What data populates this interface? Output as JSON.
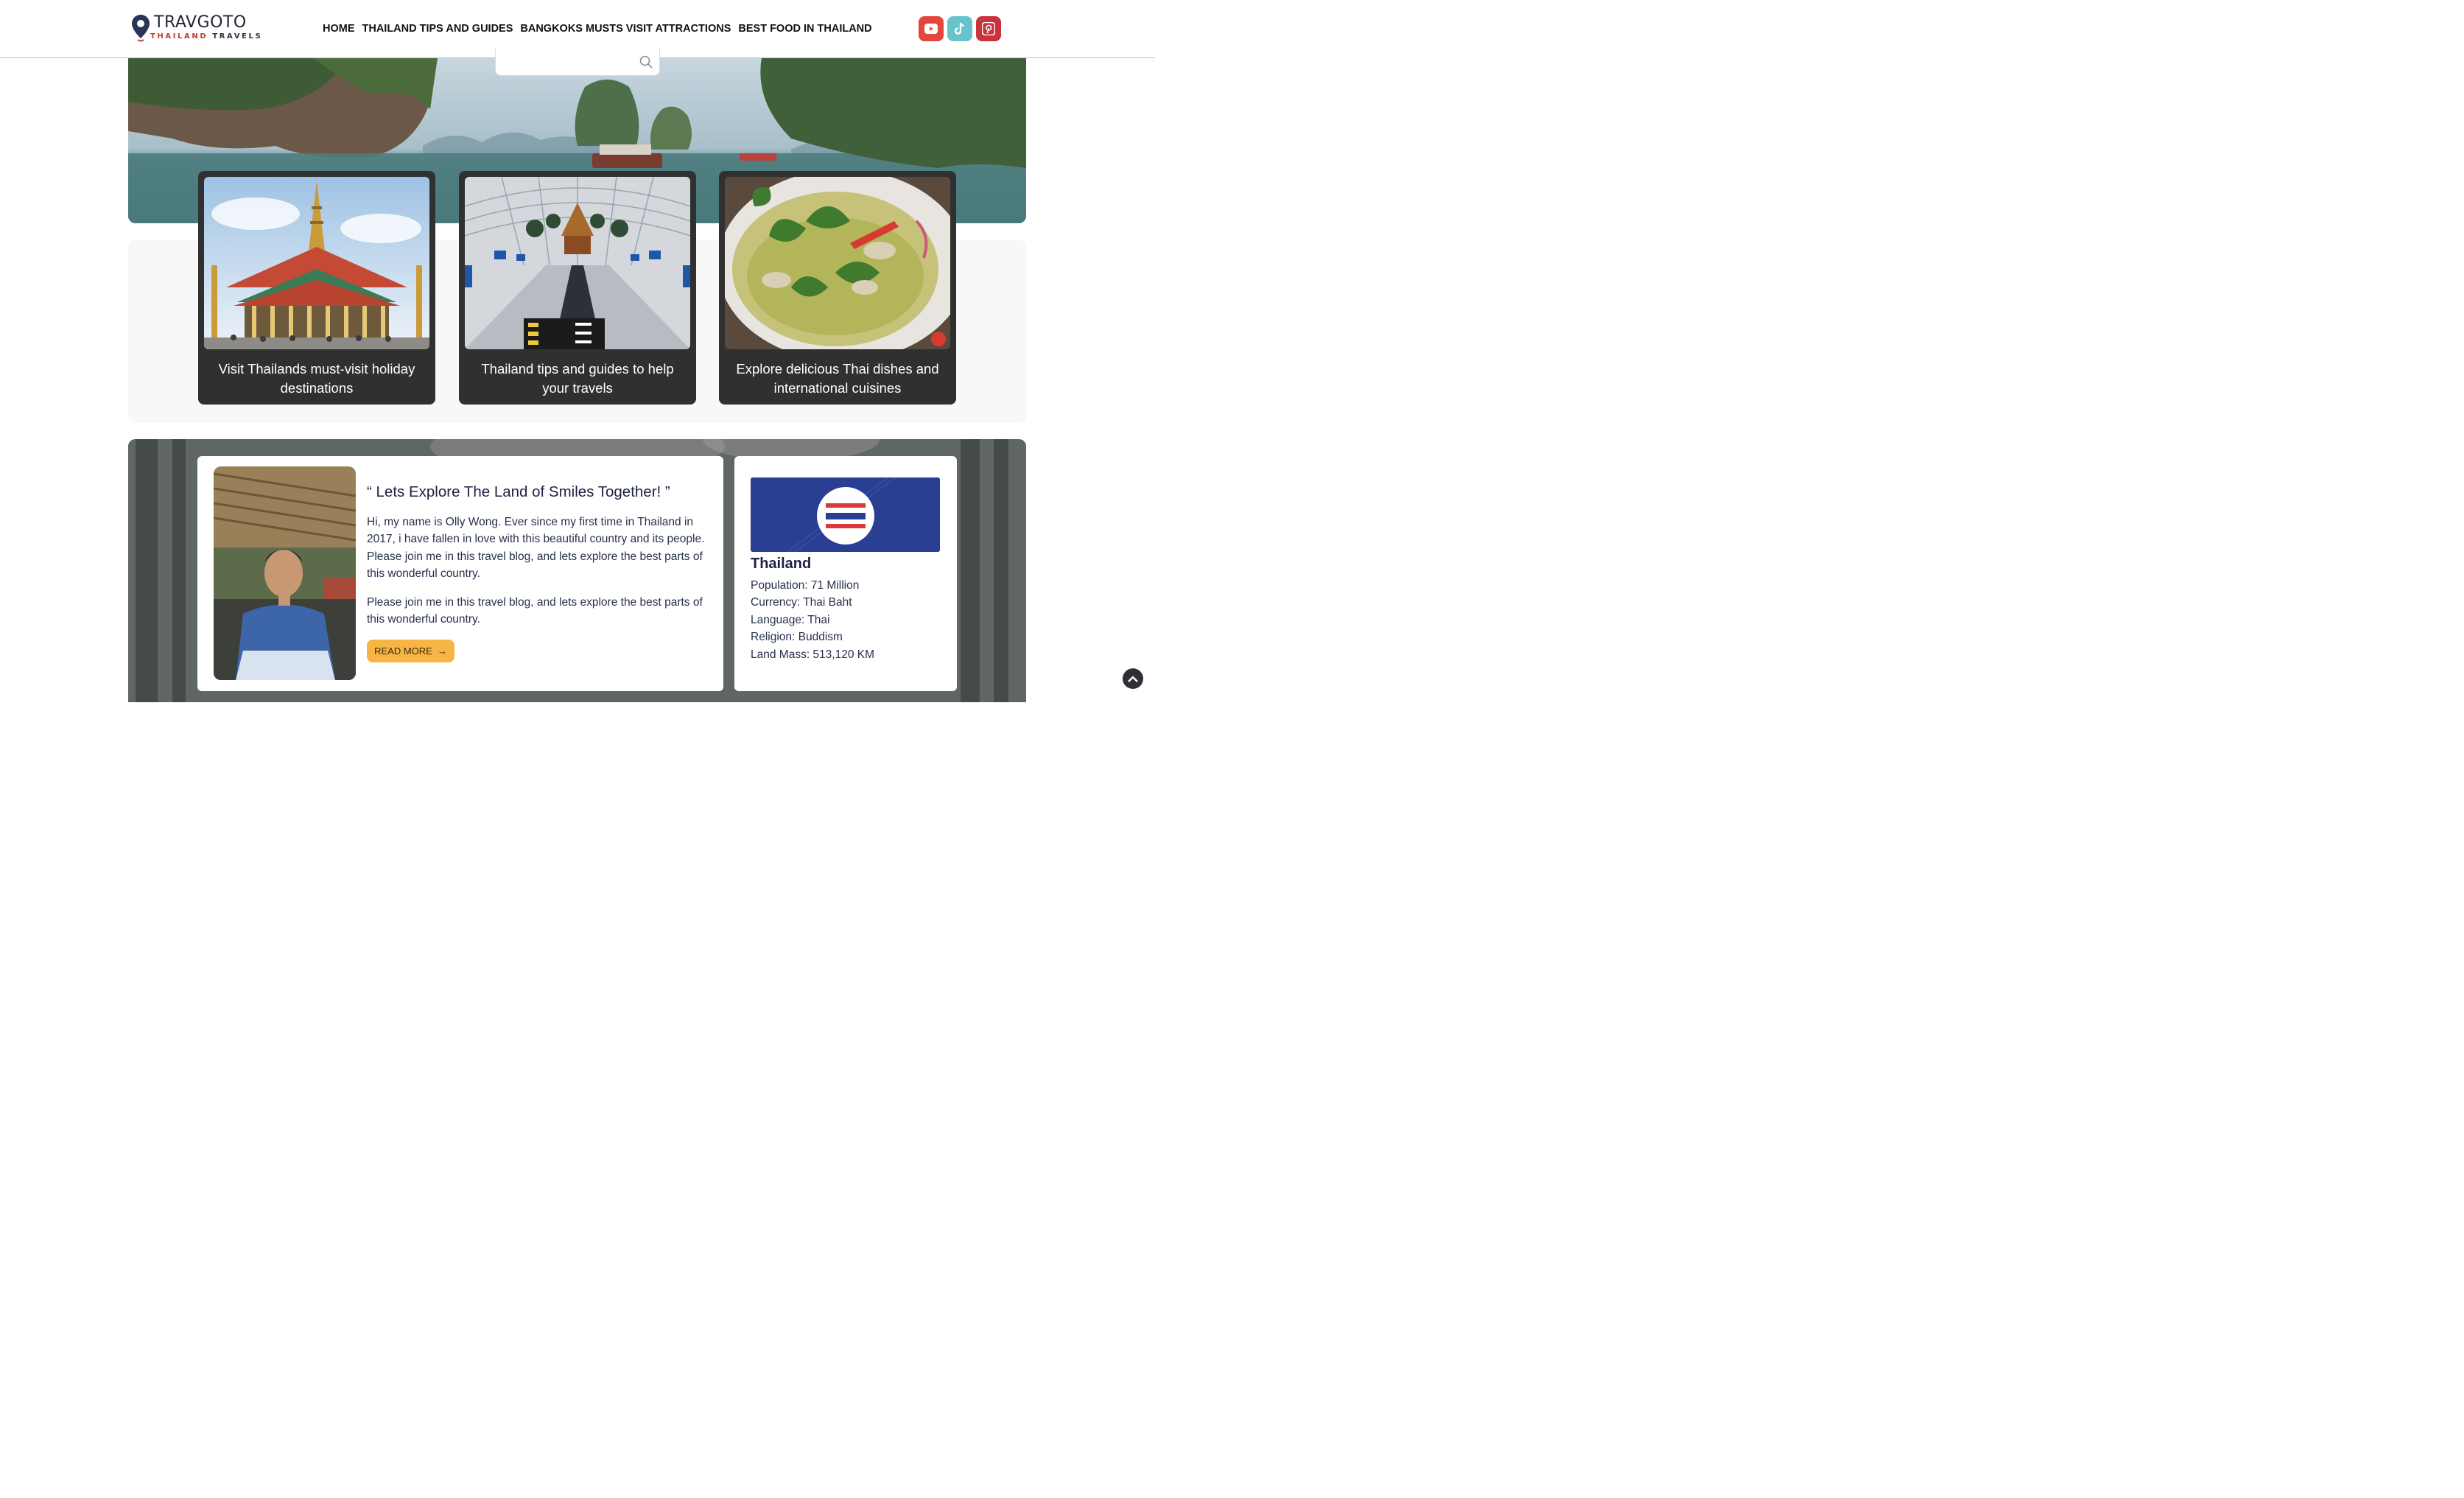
{
  "brand": {
    "name": "TRAVGOTO",
    "tagline_part1": "THAILAND",
    "tagline_part2": "TRAVELS"
  },
  "nav": {
    "items": [
      {
        "label": "HOME"
      },
      {
        "label": "THAILAND TIPS AND GUIDES"
      },
      {
        "label": "BANGKOKS MUSTS VISIT ATTRACTIONS"
      },
      {
        "label": "BEST FOOD IN THAILAND"
      }
    ]
  },
  "social": {
    "icons": [
      "youtube-icon",
      "tiktok-icon",
      "pinterest-icon"
    ],
    "colors": {
      "youtube": "#e5463c",
      "tiktok": "#69c3cb",
      "pinterest": "#c8333e"
    }
  },
  "search": {
    "placeholder": "",
    "icon": "search-icon"
  },
  "cards": [
    {
      "caption": "Visit Thailands must-visit holiday destinations",
      "image": "grand-palace-temple"
    },
    {
      "caption": "Thailand tips and guides to help your travels",
      "image": "bangkok-airport-terminal"
    },
    {
      "caption": "Explore delicious Thai dishes and international cuisines",
      "image": "thai-green-curry-bowl"
    }
  ],
  "about": {
    "title": "“ Lets Explore The Land of Smiles Together! ”",
    "paragraph1": "Hi, my name is Olly Wong. Ever since my first time in Thailand in 2017, i have fallen in love with this beautiful country and its people. Please join me in this travel blog, and lets explore the best parts of this wonderful country.",
    "paragraph2": "Please join me in this travel blog, and lets explore the best parts of this wonderful country.",
    "read_more": "READ MORE",
    "button_color": "#f6b544"
  },
  "facts": {
    "country": "Thailand",
    "items": [
      "Population: 71 Million",
      "Currency: Thai Baht",
      "Language: Thai",
      "Religion: Buddism",
      "Land Mass: 513,120 KM"
    ]
  },
  "colors": {
    "accent_navy": "#1d2244",
    "card_dark": "#303030",
    "flag_blue": "#2a3f93",
    "flag_red": "#d93a35"
  }
}
